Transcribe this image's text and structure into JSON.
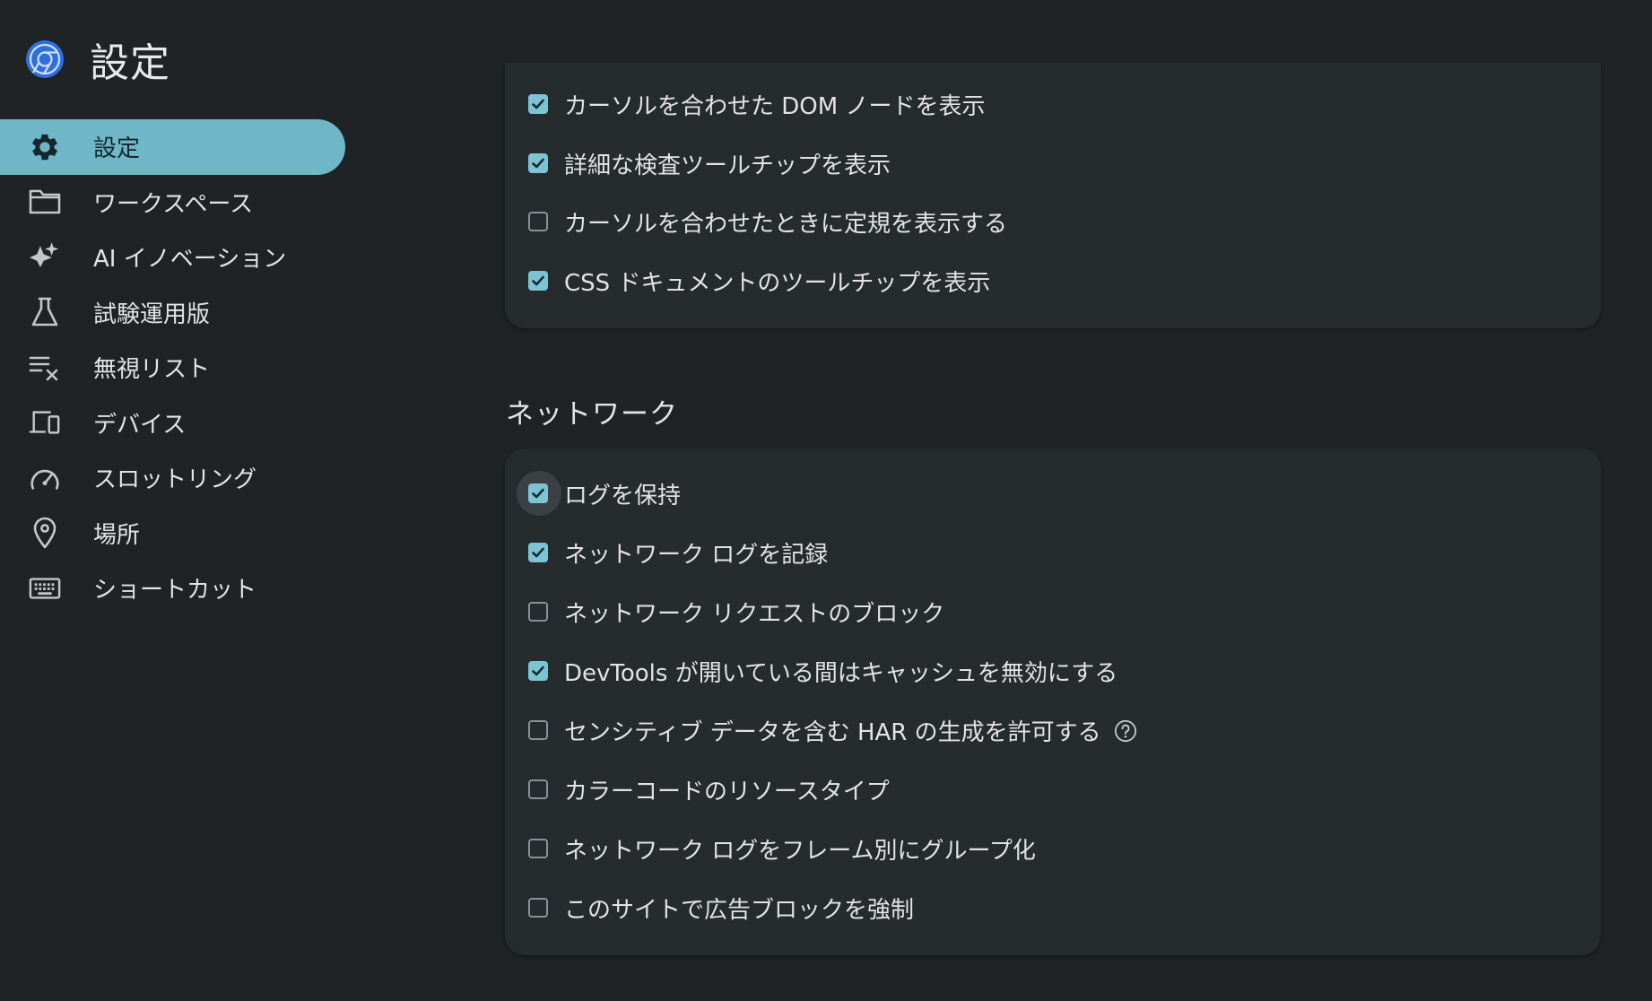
{
  "header": {
    "title": "設定",
    "logo_icon": "chrome-devtools-logo-icon"
  },
  "sidebar": {
    "items": [
      {
        "label": "設定",
        "icon": "gear-icon",
        "active": true
      },
      {
        "label": "ワークスペース",
        "icon": "folder-icon",
        "active": false
      },
      {
        "label": "AI イノベーション",
        "icon": "sparkle-icon",
        "active": false
      },
      {
        "label": "試験運用版",
        "icon": "flask-icon",
        "active": false
      },
      {
        "label": "無視リスト",
        "icon": "ignore-list-icon",
        "active": false
      },
      {
        "label": "デバイス",
        "icon": "devices-icon",
        "active": false
      },
      {
        "label": "スロットリング",
        "icon": "speedometer-icon",
        "active": false
      },
      {
        "label": "場所",
        "icon": "location-pin-icon",
        "active": false
      },
      {
        "label": "ショートカット",
        "icon": "keyboard-icon",
        "active": false
      }
    ]
  },
  "elements_section": {
    "options": [
      {
        "label": "カーソルを合わせた DOM ノードを表示",
        "checked": true
      },
      {
        "label": "詳細な検査ツールチップを表示",
        "checked": true
      },
      {
        "label": "カーソルを合わせたときに定規を表示する",
        "checked": false
      },
      {
        "label": "CSS ドキュメントのツールチップを表示",
        "checked": true
      }
    ]
  },
  "network_section": {
    "title": "ネットワーク",
    "options": [
      {
        "label": "ログを保持",
        "checked": true,
        "focused": true
      },
      {
        "label": "ネットワーク ログを記録",
        "checked": true
      },
      {
        "label": "ネットワーク リクエストのブロック",
        "checked": false
      },
      {
        "label": "DevTools が開いている間はキャッシュを無効にする",
        "checked": true
      },
      {
        "label": "センシティブ データを含む HAR の生成を許可する",
        "checked": false,
        "help": true
      },
      {
        "label": "カラーコードのリソースタイプ",
        "checked": false
      },
      {
        "label": "ネットワーク ログをフレーム別にグループ化",
        "checked": false
      },
      {
        "label": "このサイトで広告ブロックを強制",
        "checked": false
      }
    ]
  },
  "colors": {
    "background": "#1f2325",
    "card": "#262b2e",
    "accent": "#6fb6c7",
    "checkbox_on": "#7cc3d4"
  }
}
